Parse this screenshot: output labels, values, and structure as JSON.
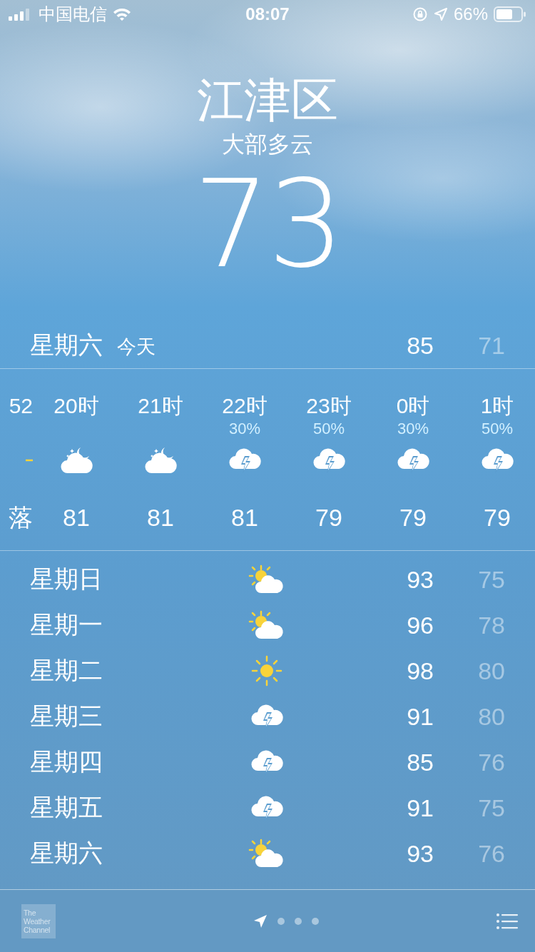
{
  "status_bar": {
    "carrier": "中国电信",
    "time": "08:07",
    "battery": "66%"
  },
  "location": {
    "city": "江津区",
    "condition": "大部多云",
    "temperature": "73"
  },
  "today": {
    "day": "星期六",
    "label": "今天",
    "high": "85",
    "low": "71"
  },
  "hourly": [
    {
      "time": "52",
      "kind": "sunset",
      "temp": "落"
    },
    {
      "time": "20时",
      "kind": "moon-cloud",
      "temp": "81"
    },
    {
      "time": "21时",
      "kind": "moon-cloud",
      "temp": "81"
    },
    {
      "time": "22时",
      "chance": "30%",
      "kind": "thunder",
      "temp": "81"
    },
    {
      "time": "23时",
      "chance": "50%",
      "kind": "thunder",
      "temp": "79"
    },
    {
      "time": "0时",
      "chance": "30%",
      "kind": "thunder",
      "temp": "79"
    },
    {
      "time": "1时",
      "chance": "50%",
      "kind": "thunder",
      "temp": "79"
    }
  ],
  "daily": [
    {
      "day": "星期日",
      "kind": "sun-cloud",
      "high": "93",
      "low": "75"
    },
    {
      "day": "星期一",
      "kind": "sun-cloud",
      "high": "96",
      "low": "78"
    },
    {
      "day": "星期二",
      "kind": "sun",
      "high": "98",
      "low": "80"
    },
    {
      "day": "星期三",
      "kind": "thunder",
      "high": "91",
      "low": "80"
    },
    {
      "day": "星期四",
      "kind": "thunder",
      "high": "85",
      "low": "76"
    },
    {
      "day": "星期五",
      "kind": "thunder",
      "high": "91",
      "low": "75"
    },
    {
      "day": "星期六",
      "kind": "sun-cloud",
      "high": "93",
      "low": "76"
    }
  ],
  "footer": {
    "logo": [
      "The",
      "Weather",
      "Channel"
    ],
    "pages": [
      {
        "kind": "location",
        "selected": true
      },
      {
        "kind": "dot",
        "selected": false
      },
      {
        "kind": "dot",
        "selected": false
      },
      {
        "kind": "dot",
        "selected": false
      }
    ]
  }
}
